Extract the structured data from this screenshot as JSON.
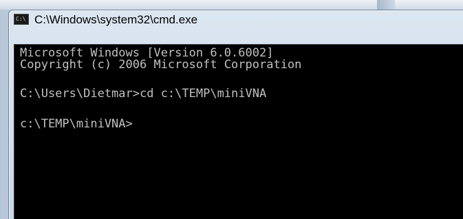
{
  "window": {
    "title": "C:\\Windows\\system32\\cmd.exe",
    "icon_name": "cmd-icon",
    "icon_text": "C:\\"
  },
  "console": {
    "lines": [
      "Microsoft Windows [Version 6.0.6002]",
      "Copyright (c) 2006 Microsoft Corporation",
      "C:\\Users\\Dietmar>cd c:\\TEMP\\miniVNA",
      "c:\\TEMP\\miniVNA>"
    ],
    "background": "#000000",
    "foreground": "#c0c0c0"
  }
}
